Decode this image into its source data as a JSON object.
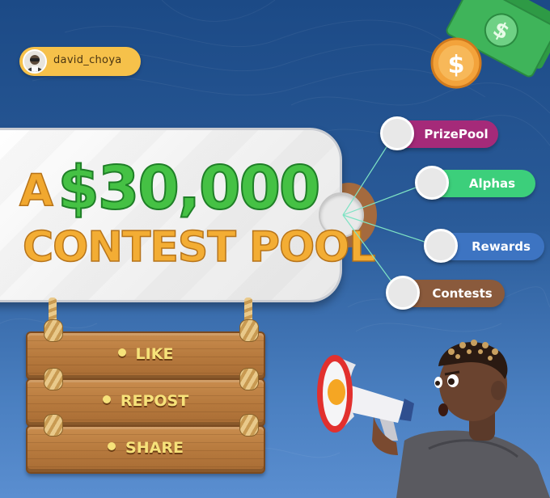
{
  "profile": {
    "username": "david_choya",
    "avatar_icon": "user-avatar"
  },
  "headline": {
    "prefix": "A",
    "amount": "$30,000",
    "line2": "CONTEST POOL"
  },
  "categories": [
    {
      "label": "PrizePool",
      "color": "#a52a79"
    },
    {
      "label": "Alphas",
      "color": "#3ccf7b"
    },
    {
      "label": "Rewards",
      "color": "#3d74c2"
    },
    {
      "label": "Contests",
      "color": "#8a5a3c"
    }
  ],
  "signboard": {
    "items": [
      "LIKE",
      "REPOST",
      "SHARE"
    ]
  },
  "decor": {
    "money_icon": "cash-and-coin",
    "megaphone_icon": "megaphone"
  }
}
